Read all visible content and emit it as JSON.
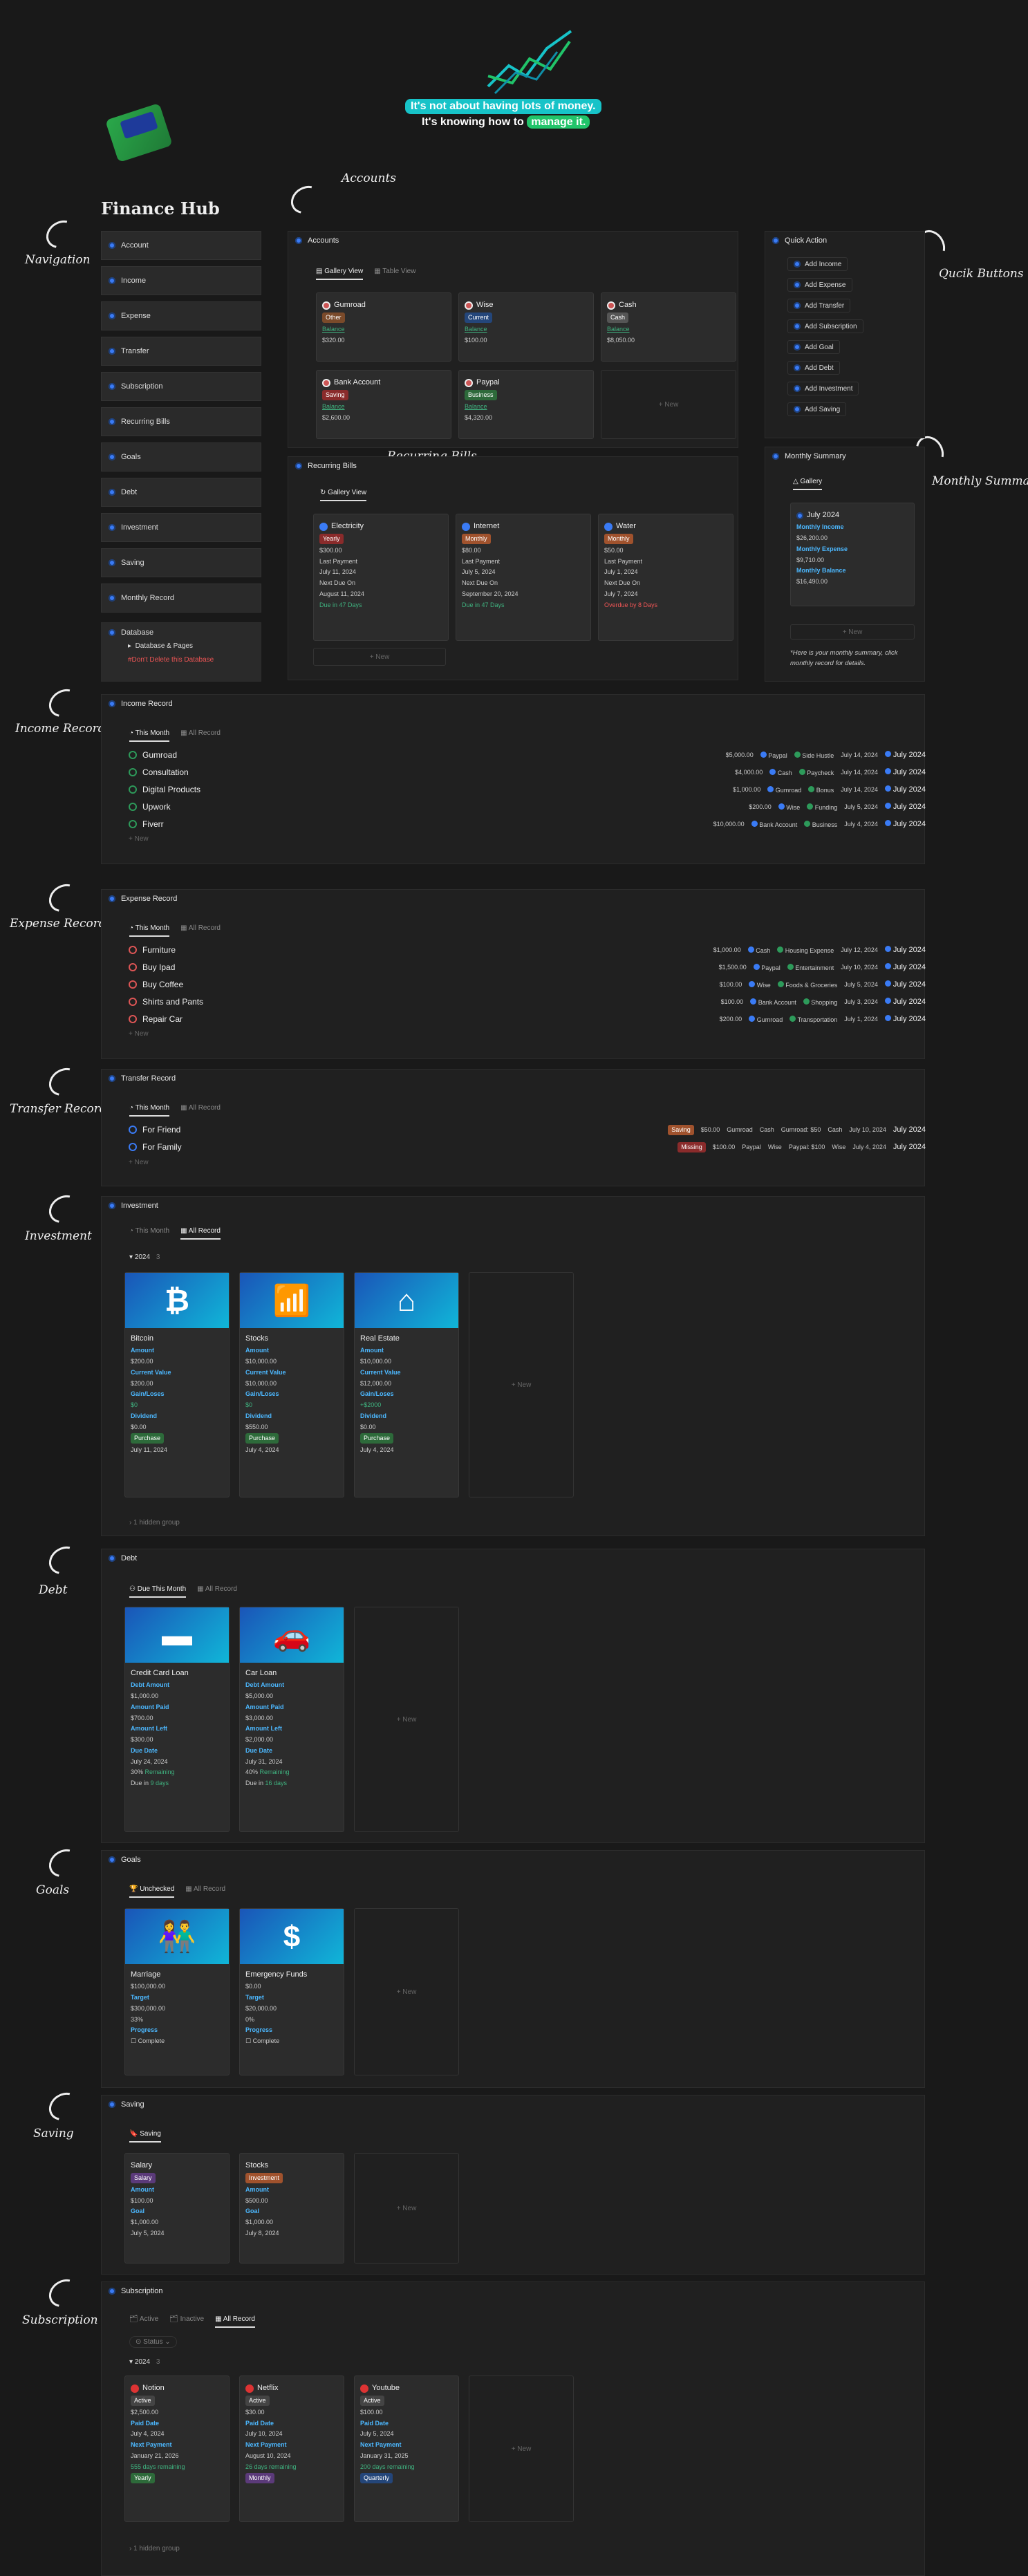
{
  "quote": {
    "line1": "It's not about having lots of money.",
    "line2a": "It's knowing how to ",
    "line2b": "manage it."
  },
  "title": "Finance Hub",
  "annotations": {
    "accounts": "Accounts",
    "navigation": "Navigation",
    "quick": "Qucik Buttons",
    "recurring": "Recurring Bills",
    "monthly": "Monthly Summary",
    "income": "Income Record",
    "expense": "Expense Record",
    "transfer": "Transfer Record",
    "investment": "Investment",
    "debt": "Debt",
    "goals": "Goals",
    "saving": "Saving",
    "subscription": "Subscription"
  },
  "nav": [
    "Account",
    "Income",
    "Expense",
    "Transfer",
    "Subscription",
    "Recurring Bills",
    "Goals",
    "Debt",
    "Investment",
    "Saving",
    "Monthly Record"
  ],
  "database": {
    "title": "Database",
    "item": "Database & Pages",
    "warn": "#Don't Delete this Database"
  },
  "accounts": {
    "title": "Accounts",
    "tab1": "Gallery View",
    "tab2": "Table View",
    "new": "+ New",
    "items": [
      {
        "name": "Gumroad",
        "tag": "Other",
        "bal": "Balance",
        "amt": "$320.00",
        "tagc": "#7a4a2a"
      },
      {
        "name": "Wise",
        "tag": "Current",
        "bal": "Balance",
        "amt": "$100.00",
        "tagc": "#24467a"
      },
      {
        "name": "Cash",
        "tag": "Cash",
        "bal": "Balance",
        "amt": "$8,050.00",
        "tagc": "#555"
      },
      {
        "name": "Bank Account",
        "tag": "Saving",
        "bal": "Balance",
        "amt": "$2,600.00",
        "tagc": "#8a2b2b"
      },
      {
        "name": "Paypal",
        "tag": "Business",
        "bal": "Balance",
        "amt": "$4,320.00",
        "tagc": "#2d6a3a"
      }
    ]
  },
  "recurring": {
    "title": "Recurring Bills",
    "tab": "Gallery View",
    "new": "+ New",
    "items": [
      {
        "name": "Electricity",
        "tag": "Yearly",
        "amt": "$300.00",
        "lp": "Last Payment",
        "lpd": "July 11, 2024",
        "nd": "Next Due On",
        "ndd": "August 11, 2024",
        "due": "Due in 47 Days",
        "tagc": "#8a2b2b"
      },
      {
        "name": "Internet",
        "tag": "Monthly",
        "amt": "$80.00",
        "lp": "Last Payment",
        "lpd": "July 5, 2024",
        "nd": "Next Due On",
        "ndd": "September 20, 2024",
        "due": "Due in 47 Days",
        "tagc": "#a0522d"
      },
      {
        "name": "Water",
        "tag": "Monthly",
        "amt": "$50.00",
        "lp": "Last Payment",
        "lpd": "July 1, 2024",
        "nd": "Next Due On",
        "ndd": "July 7, 2024",
        "due": "Overdue by 8 Days",
        "tagc": "#a0522d"
      }
    ]
  },
  "quick": {
    "title": "Quick Action",
    "buttons": [
      "Add Income",
      "Add Expense",
      "Add Transfer",
      "Add Subscription",
      "Add Goal",
      "Add Debt",
      "Add Investment",
      "Add Saving"
    ]
  },
  "monthly": {
    "title": "Monthly Summary",
    "tab": "Gallery",
    "month": "July 2024",
    "l1": "Monthly Income",
    "v1": "$26,200.00",
    "l2": "Monthly Expense",
    "v2": "$9,710.00",
    "l3": "Monthly Balance",
    "v3": "$16,490.00",
    "new": "+ New",
    "note": "*Here is your monthly summary, click monthly record for details."
  },
  "income": {
    "title": "Income Record",
    "tab1": "This Month",
    "tab2": "All Record",
    "new": "+ New",
    "rows": [
      {
        "name": "Gumroad",
        "amt": "$5,000.00",
        "acct": "Paypal",
        "cat": "Side Hustle",
        "date": "July 14, 2024",
        "month": "July 2024"
      },
      {
        "name": "Consultation",
        "amt": "$4,000.00",
        "acct": "Cash",
        "cat": "Paycheck",
        "date": "July 14, 2024",
        "month": "July 2024"
      },
      {
        "name": "Digital Products",
        "amt": "$1,000.00",
        "acct": "Gumroad",
        "cat": "Bonus",
        "date": "July 14, 2024",
        "month": "July 2024"
      },
      {
        "name": "Upwork",
        "amt": "$200.00",
        "acct": "Wise",
        "cat": "Funding",
        "date": "July 5, 2024",
        "month": "July 2024"
      },
      {
        "name": "Fiverr",
        "amt": "$10,000.00",
        "acct": "Bank Account",
        "cat": "Business",
        "date": "July 4, 2024",
        "month": "July 2024"
      }
    ]
  },
  "expense": {
    "title": "Expense Record",
    "tab1": "This Month",
    "tab2": "All Record",
    "new": "+ New",
    "rows": [
      {
        "name": "Furniture",
        "amt": "$1,000.00",
        "acct": "Cash",
        "cat": "Housing Expense",
        "date": "July 12, 2024",
        "month": "July 2024"
      },
      {
        "name": "Buy Ipad",
        "amt": "$1,500.00",
        "acct": "Paypal",
        "cat": "Entertainment",
        "date": "July 10, 2024",
        "month": "July 2024"
      },
      {
        "name": "Buy Coffee",
        "amt": "$100.00",
        "acct": "Wise",
        "cat": "Foods & Groceries",
        "date": "July 5, 2024",
        "month": "July 2024"
      },
      {
        "name": "Shirts and Pants",
        "amt": "$100.00",
        "acct": "Bank Account",
        "cat": "Shopping",
        "date": "July 3, 2024",
        "month": "July 2024"
      },
      {
        "name": "Repair Car",
        "amt": "$200.00",
        "acct": "Gumroad",
        "cat": "Transportation",
        "date": "July 1, 2024",
        "month": "July 2024"
      }
    ]
  },
  "transfer": {
    "title": "Transfer Record",
    "tab1": "This Month",
    "tab2": "All Record",
    "new": "+ New",
    "rows": [
      {
        "name": "For Friend",
        "tag": "Saving",
        "amt": "$50.00",
        "from": "Gumroad",
        "to": "Cash",
        "fee": "Gumroad: $50",
        "fee2": "Cash",
        "date": "July 10, 2024",
        "month": "July 2024"
      },
      {
        "name": "For Family",
        "tag": "Missing",
        "amt": "$100.00",
        "from": "Paypal",
        "to": "Wise",
        "fee": "Paypal: $100",
        "fee2": "Wise",
        "date": "July 4, 2024",
        "month": "July 2024"
      }
    ]
  },
  "investment": {
    "title": "Investment",
    "tab1": "This Month",
    "tab2": "All Record",
    "group": "2024",
    "groupn": "3",
    "hidden": "1 hidden group",
    "new": "+ New",
    "items": [
      {
        "name": "Bitcoin",
        "l1": "Amount",
        "v1": "$200.00",
        "l2": "Current Value",
        "v2": "$200.00",
        "l3": "Gain/Loses",
        "v3": "$0",
        "l4": "Dividend",
        "v4": "$0.00",
        "tag": "Purchase",
        "date": "July 11, 2024",
        "icon": "₿"
      },
      {
        "name": "Stocks",
        "l1": "Amount",
        "v1": "$10,000.00",
        "l2": "Current Value",
        "v2": "$10,000.00",
        "l3": "Gain/Loses",
        "v3": "$0",
        "l4": "Dividend",
        "v4": "$550.00",
        "tag": "Purchase",
        "date": "July 4, 2024",
        "icon": "📶"
      },
      {
        "name": "Real Estate",
        "l1": "Amount",
        "v1": "$10,000.00",
        "l2": "Current Value",
        "v2": "$12,000.00",
        "l3": "Gain/Loses",
        "v3": "+$2000",
        "l4": "Dividend",
        "v4": "$0.00",
        "tag": "Purchase",
        "date": "July 4, 2024",
        "icon": "⌂"
      }
    ]
  },
  "debt": {
    "title": "Debt",
    "tab1": "Due This Month",
    "tab2": "All Record",
    "new": "+ New",
    "items": [
      {
        "name": "Credit Card Loan",
        "l1": "Debt Amount",
        "v1": "$1,000.00",
        "l2": "Amount Paid",
        "v2": "$700.00",
        "l3": "Amount Left",
        "v3": "$300.00",
        "l4": "Due Date",
        "v4": "July 24, 2024",
        "pct": "30%",
        "rem": "Remaining",
        "duein": "Due in",
        "days": "9 days",
        "icon": "▬"
      },
      {
        "name": "Car Loan",
        "l1": "Debt Amount",
        "v1": "$5,000.00",
        "l2": "Amount Paid",
        "v2": "$3,000.00",
        "l3": "Amount Left",
        "v3": "$2,000.00",
        "l4": "Due Date",
        "v4": "July 31, 2024",
        "pct": "40%",
        "rem": "Remaining",
        "duein": "Due in",
        "days": "16 days",
        "icon": "🚗"
      }
    ]
  },
  "goals": {
    "title": "Goals",
    "tab1": "Unchecked",
    "tab2": "All Record",
    "new": "+ New",
    "items": [
      {
        "name": "Marriage",
        "v1": "$100,000.00",
        "l2": "Target",
        "v2": "$300,000.00",
        "pct": "33%",
        "l3": "Progress",
        "chk": "Complete",
        "icon": "👫"
      },
      {
        "name": "Emergency Funds",
        "v1": "$0.00",
        "l2": "Target",
        "v2": "$20,000.00",
        "pct": "0%",
        "l3": "Progress",
        "chk": "Complete",
        "icon": "$"
      }
    ]
  },
  "saving": {
    "title": "Saving",
    "tab": "Saving",
    "new": "+ New",
    "items": [
      {
        "name": "Salary",
        "tag": "Salary",
        "l1": "Amount",
        "v1": "$100.00",
        "l2": "Goal",
        "v2": "$1,000.00",
        "date": "July 5, 2024",
        "tagc": "#5b3a7a"
      },
      {
        "name": "Stocks",
        "tag": "Investment",
        "l1": "Amount",
        "v1": "$500.00",
        "l2": "Goal",
        "v2": "$1,000.00",
        "date": "July 8, 2024",
        "tagc": "#a0522d"
      }
    ]
  },
  "subscription": {
    "title": "Subscription",
    "tab1": "Active",
    "tab2": "Inactive",
    "tab3": "All Record",
    "status": "Status",
    "group": "2024",
    "groupn": "3",
    "hidden": "1 hidden group",
    "new": "+ New",
    "items": [
      {
        "name": "Notion",
        "tag": "Active",
        "v1": "$2,500.00",
        "l2": "Paid Date",
        "v2": "July 4, 2024",
        "l3": "Next Payment",
        "v3": "January 21, 2026",
        "rem": "555 days remaining",
        "cyc": "Yearly",
        "cycc": "#2d6a3a"
      },
      {
        "name": "Netflix",
        "tag": "Active",
        "v1": "$30.00",
        "l2": "Paid Date",
        "v2": "July 10, 2024",
        "l3": "Next Payment",
        "v3": "August 10, 2024",
        "rem": "26 days remaining",
        "cyc": "Monthly",
        "cycc": "#5b3a7a"
      },
      {
        "name": "Youtube",
        "tag": "Active",
        "v1": "$100.00",
        "l2": "Paid Date",
        "v2": "July 5, 2024",
        "l3": "Next Payment",
        "v3": "January 31, 2025",
        "rem": "200 days remaining",
        "cyc": "Quarterly",
        "cycc": "#24467a"
      }
    ]
  }
}
